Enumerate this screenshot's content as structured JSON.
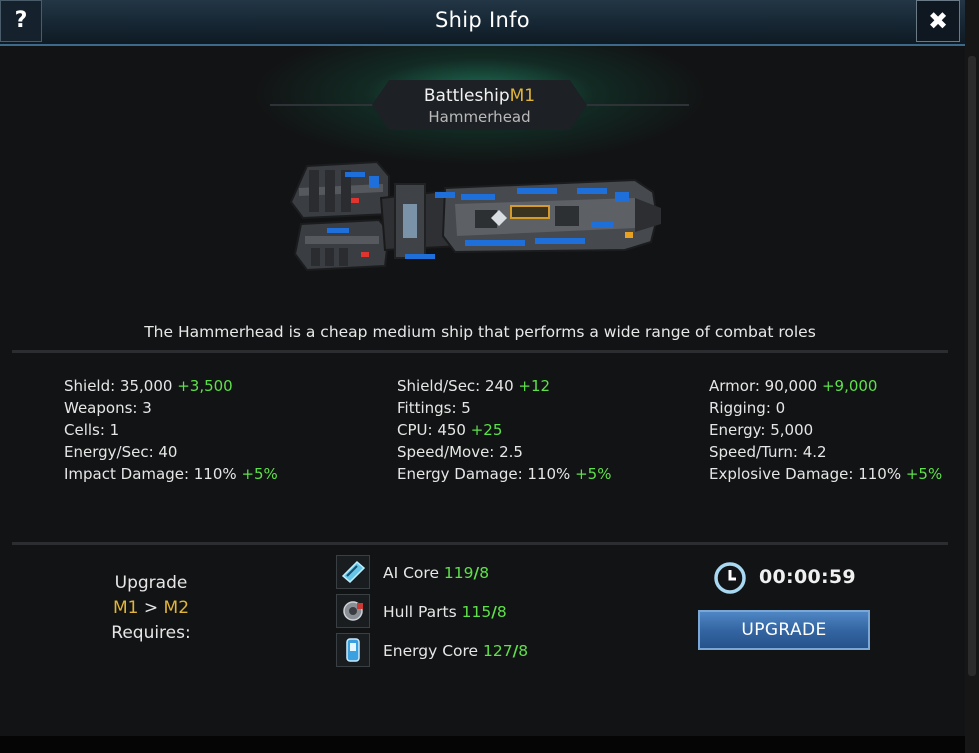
{
  "header": {
    "title": "Ship Info",
    "help_label": "?",
    "close_label": "✖"
  },
  "ship": {
    "class": "Battleship",
    "tier": "M1",
    "model": "Hammerhead",
    "description": "The Hammerhead is a cheap medium ship that performs a wide range of combat roles"
  },
  "stats": {
    "col1": [
      {
        "label": "Shield: 35,000",
        "bonus": "+3,500"
      },
      {
        "label": "Weapons: 3",
        "bonus": ""
      },
      {
        "label": "Cells: 1",
        "bonus": ""
      },
      {
        "label": "Energy/Sec: 40",
        "bonus": ""
      },
      {
        "label": "Impact Damage: 110%",
        "bonus": "+5%"
      }
    ],
    "col2": [
      {
        "label": "Shield/Sec: 240",
        "bonus": "+12"
      },
      {
        "label": "Fittings: 5",
        "bonus": ""
      },
      {
        "label": "CPU: 450",
        "bonus": "+25"
      },
      {
        "label": "Speed/Move: 2.5",
        "bonus": ""
      },
      {
        "label": "Energy Damage: 110%",
        "bonus": "+5%"
      }
    ],
    "col3": [
      {
        "label": "Armor: 90,000",
        "bonus": "+9,000"
      },
      {
        "label": "Rigging: 0",
        "bonus": ""
      },
      {
        "label": "Energy: 5,000",
        "bonus": ""
      },
      {
        "label": "Speed/Turn: 4.2",
        "bonus": ""
      },
      {
        "label": "Explosive Damage: 110%",
        "bonus": "+5%"
      }
    ]
  },
  "upgrade": {
    "label": "Upgrade",
    "from": "M1",
    "arrow": ">",
    "to": "M2",
    "requires_label": "Requires:",
    "requirements": [
      {
        "name": "AI Core",
        "have": "119",
        "sep": "/",
        "need": "8",
        "icon": "ai-core-icon"
      },
      {
        "name": "Hull Parts",
        "have": "115",
        "sep": "/",
        "need": "8",
        "icon": "hull-parts-icon"
      },
      {
        "name": "Energy Core",
        "have": "127",
        "sep": "/",
        "need": "8",
        "icon": "energy-core-icon"
      }
    ],
    "timer": "00:00:59",
    "button_label": "UPGRADE"
  },
  "colors": {
    "bonus": "#5ee04b",
    "tier": "#e0b53a",
    "button": "#3466a3"
  }
}
